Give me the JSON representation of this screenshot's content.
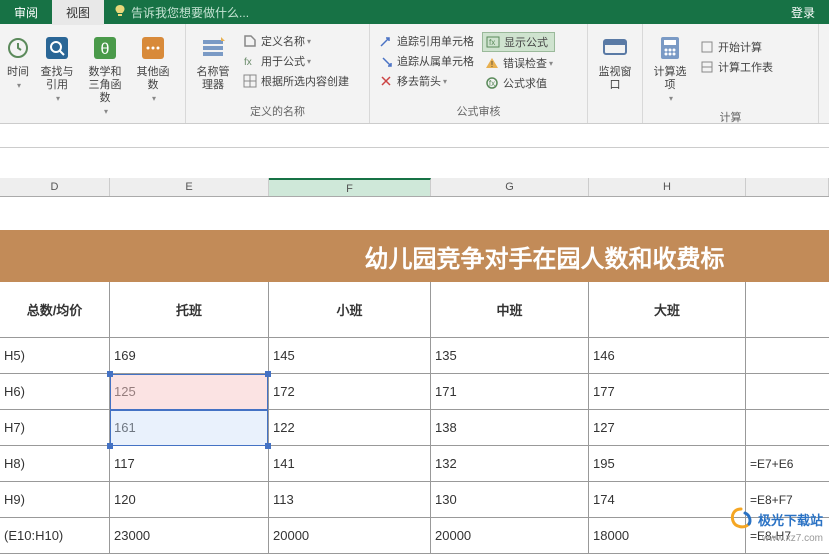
{
  "topbar": {
    "tab_review": "审阅",
    "tab_view": "视图",
    "tell_me": "告诉我您想要做什么...",
    "login": "登录"
  },
  "ribbon": {
    "time": "时间",
    "lookup_ref": "查找与引用",
    "math_trig": "数学和三角函数",
    "more_funcs": "其他函数",
    "name_manager": "名称管理器",
    "define_name": "定义名称",
    "use_in_formula": "用于公式",
    "create_from_sel": "根据所选内容创建",
    "group_defined_names": "定义的名称",
    "trace_prec": "追踪引用单元格",
    "trace_dep": "追踪从属单元格",
    "remove_arrows": "移去箭头",
    "show_formulas": "显示公式",
    "error_check": "错误检查",
    "eval_formula": "公式求值",
    "group_formula_audit": "公式审核",
    "watch_window": "监视窗口",
    "calc_options": "计算选项",
    "calc_now": "开始计算",
    "calc_sheet": "计算工作表",
    "group_calc": "计算"
  },
  "columns": {
    "D": "D",
    "E": "E",
    "F": "F",
    "G": "G",
    "H": "H"
  },
  "title": "幼儿园竞争对手在园人数和收费标",
  "headers": {
    "c0": "总数/均价",
    "c1": "托班",
    "c2": "小班",
    "c3": "中班",
    "c4": "大班"
  },
  "rows": [
    {
      "c0": "H5)",
      "c1": "169",
      "c2": "145",
      "c3": "135",
      "c4": "146",
      "c5": ""
    },
    {
      "c0": "H6)",
      "c1": "125",
      "c2": "172",
      "c3": "171",
      "c4": "177",
      "c5": ""
    },
    {
      "c0": "H7)",
      "c1": "161",
      "c2": "122",
      "c3": "138",
      "c4": "127",
      "c5": ""
    },
    {
      "c0": "H8)",
      "c1": "117",
      "c2": "141",
      "c3": "132",
      "c4": "195",
      "c5": "=E7+E6"
    },
    {
      "c0": "H9)",
      "c1": "120",
      "c2": "113",
      "c3": "130",
      "c4": "174",
      "c5": "=E8+F7"
    },
    {
      "c0": "(E10:H10)",
      "c1": "23000",
      "c2": "20000",
      "c3": "20000",
      "c4": "18000",
      "c5": "=E8-H7"
    }
  ],
  "watermark": {
    "text": "极光下载站",
    "url": "www.xz7.com"
  }
}
